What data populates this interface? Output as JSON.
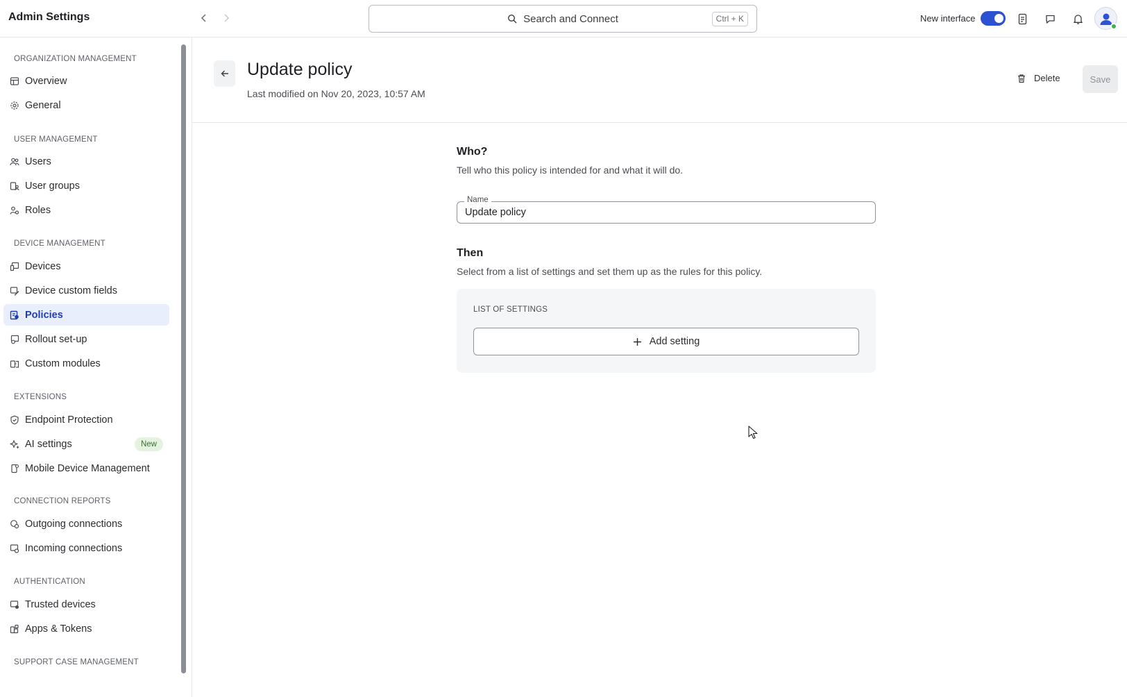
{
  "app": {
    "title": "Admin Settings"
  },
  "search": {
    "label": "Search and Connect",
    "shortcut": "Ctrl + K"
  },
  "topbar": {
    "toggle_label": "New interface",
    "toggle_on": true,
    "accent": "#2c52d1"
  },
  "sidebar": {
    "sections": [
      {
        "title": "ORGANIZATION MANAGEMENT",
        "items": [
          {
            "label": "Overview",
            "icon": "dashboard-icon"
          },
          {
            "label": "General",
            "icon": "gear-icon"
          }
        ]
      },
      {
        "title": "USER MANAGEMENT",
        "items": [
          {
            "label": "Users",
            "icon": "users-icon"
          },
          {
            "label": "User groups",
            "icon": "user-groups-icon"
          },
          {
            "label": "Roles",
            "icon": "roles-icon"
          }
        ]
      },
      {
        "title": "DEVICE MANAGEMENT",
        "items": [
          {
            "label": "Devices",
            "icon": "devices-icon"
          },
          {
            "label": "Device custom fields",
            "icon": "custom-fields-icon"
          },
          {
            "label": "Policies",
            "icon": "policies-icon",
            "active": true
          },
          {
            "label": "Rollout set-up",
            "icon": "rollout-icon"
          },
          {
            "label": "Custom modules",
            "icon": "modules-icon"
          }
        ]
      },
      {
        "title": "EXTENSIONS",
        "items": [
          {
            "label": "Endpoint Protection",
            "icon": "shield-icon"
          },
          {
            "label": "AI settings",
            "icon": "sparkle-icon",
            "badge": "New"
          },
          {
            "label": "Mobile Device Management",
            "icon": "mobile-icon"
          }
        ]
      },
      {
        "title": "CONNECTION REPORTS",
        "items": [
          {
            "label": "Outgoing connections",
            "icon": "outgoing-icon"
          },
          {
            "label": "Incoming connections",
            "icon": "incoming-icon"
          }
        ]
      },
      {
        "title": "AUTHENTICATION",
        "items": [
          {
            "label": "Trusted devices",
            "icon": "trusted-device-icon"
          },
          {
            "label": "Apps & Tokens",
            "icon": "apps-icon"
          }
        ]
      },
      {
        "title": "SUPPORT CASE MANAGEMENT",
        "items": []
      }
    ]
  },
  "header": {
    "title": "Update policy",
    "subtitle": "Last modified on Nov 20, 2023, 10:57 AM",
    "delete_label": "Delete",
    "save_label": "Save"
  },
  "form": {
    "who_title": "Who?",
    "who_desc": "Tell who this policy is intended for and what it will do.",
    "name_label": "Name",
    "name_value": "Update policy",
    "then_title": "Then",
    "then_desc": "Select from a list of settings and set them up as the rules for this policy.",
    "settings_title": "LIST OF SETTINGS",
    "add_setting_label": "Add setting"
  }
}
